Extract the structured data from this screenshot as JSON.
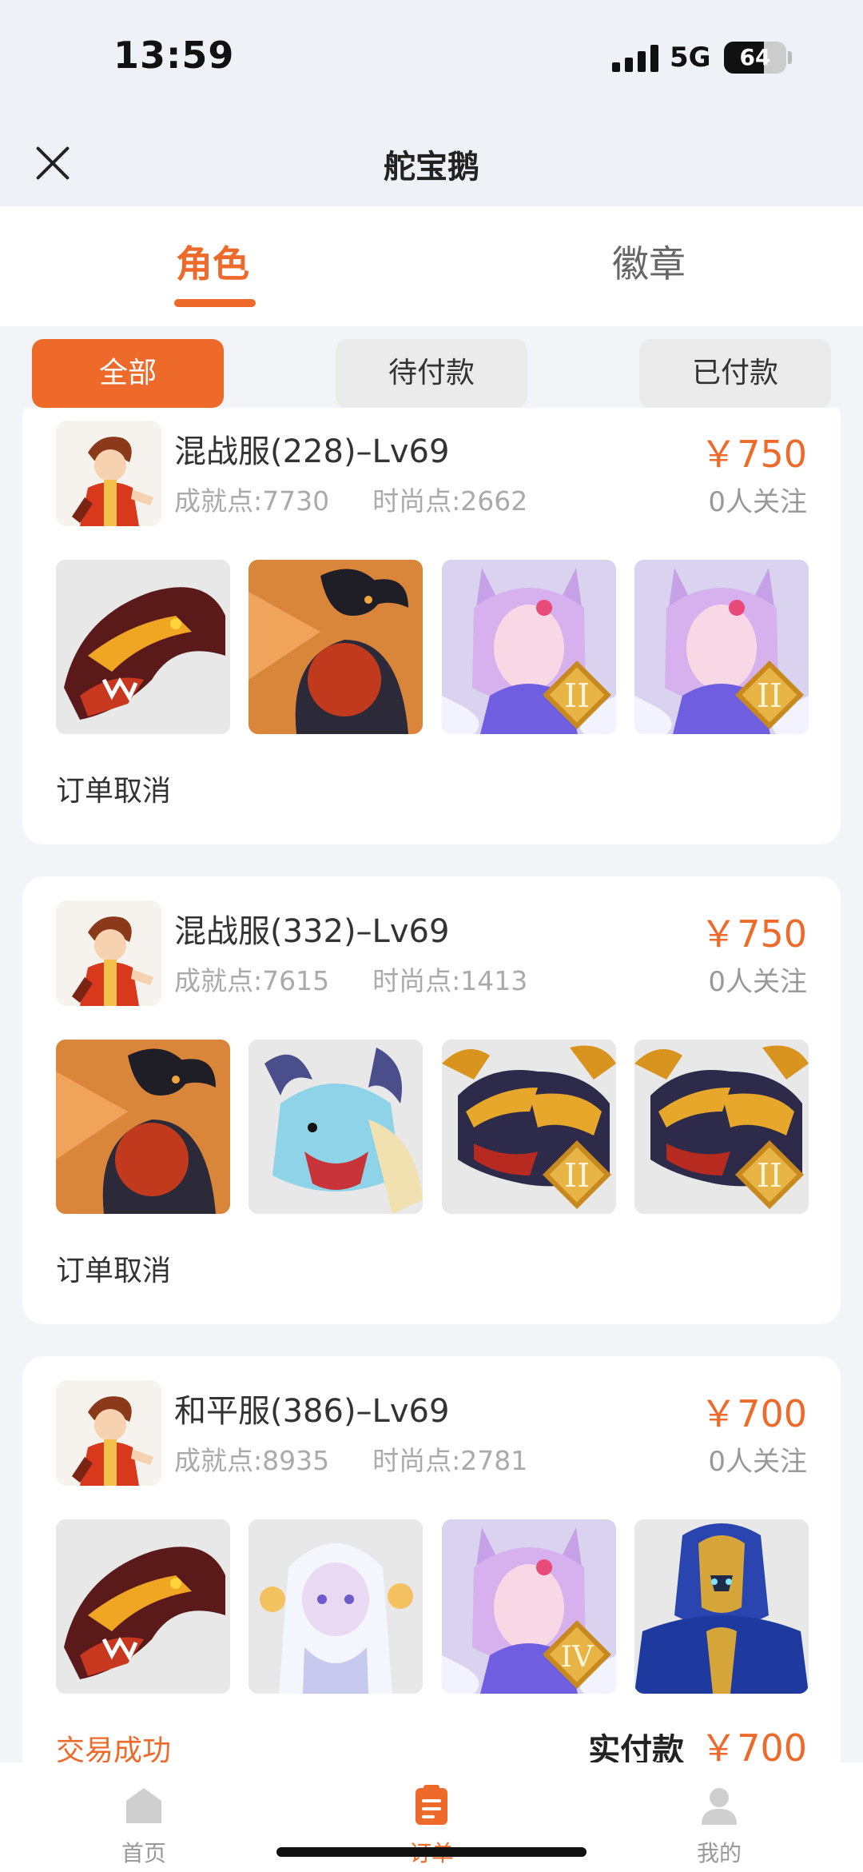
{
  "status_bar": {
    "time": "13:59",
    "network": "5G",
    "battery": "64"
  },
  "header": {
    "title": "舵宝鹅"
  },
  "tabs": [
    {
      "label": "角色",
      "active": true
    },
    {
      "label": "徽章",
      "active": false
    }
  ],
  "filters": [
    {
      "label": "全部",
      "active": true
    },
    {
      "label": "待付款",
      "active": false
    },
    {
      "label": "已付款",
      "active": false
    }
  ],
  "orders": [
    {
      "name": "混战服(228)–Lv69",
      "achievement": "成就点:7730",
      "fashion": "时尚点:2662",
      "price": "￥750",
      "follow": "0人关注",
      "status": "订单取消",
      "items": [
        "dragon-pet-image",
        "black-ram-pet-image",
        "fox-spirit-image",
        "fox-spirit-image"
      ]
    },
    {
      "name": "混战服(332)–Lv69",
      "achievement": "成就点:7615",
      "fashion": "时尚点:1413",
      "price": "￥750",
      "follow": "0人关注",
      "status": "订单取消",
      "items": [
        "black-ram-pet-image",
        "ice-dragon-image",
        "golden-dragon-image",
        "golden-dragon-image"
      ]
    },
    {
      "name": "和平服(386)–Lv69",
      "achievement": "成就点:8935",
      "fashion": "时尚点:2781",
      "price": "￥700",
      "follow": "0人关注",
      "status": "交易成功",
      "paid_label": "实付款",
      "paid_amount": "￥700",
      "items": [
        "dragon-pet-image",
        "white-spirit-image",
        "fox-spirit-image",
        "armored-knight-image"
      ]
    }
  ],
  "bottom_nav": [
    {
      "label": "首页",
      "icon": "home-icon",
      "active": false
    },
    {
      "label": "订单",
      "icon": "order-icon",
      "active": true
    },
    {
      "label": "我的",
      "icon": "profile-icon",
      "active": false
    }
  ],
  "colors": {
    "accent": "#ee6a2a",
    "background": "#f3f4f8"
  }
}
